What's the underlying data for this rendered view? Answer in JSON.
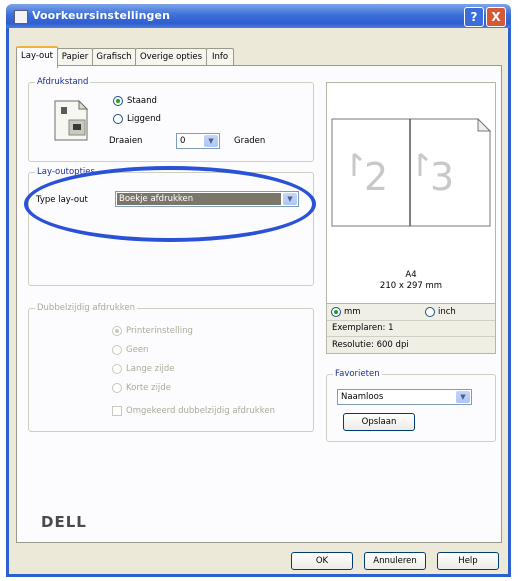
{
  "window": {
    "title": "Voorkeursinstellingen",
    "help_label": "?",
    "close_label": "X"
  },
  "tabs": [
    {
      "label": "Lay-out",
      "active": true
    },
    {
      "label": "Papier"
    },
    {
      "label": "Grafisch"
    },
    {
      "label": "Overige opties"
    },
    {
      "label": "Info"
    }
  ],
  "afdrukstand": {
    "title": "Afdrukstand",
    "staand": "Staand",
    "liggend": "Liggend",
    "draaien_label": "Draaien",
    "draaien_value": "0",
    "graden_label": "Graden",
    "selected": "Staand"
  },
  "layout_options": {
    "title": "Lay-outopties",
    "type_label": "Type lay-out",
    "type_value": "Boekje afdrukken"
  },
  "duplex": {
    "title": "Dubbelzijdig afdrukken",
    "options": [
      "Printerinstelling",
      "Geen",
      "Lange zijde",
      "Korte zijde"
    ],
    "selected": "Printerinstelling",
    "reverse_label": "Omgekeerd dubbelzijdig afdrukken"
  },
  "preview": {
    "page_left": "2",
    "page_right": "3",
    "paper": "A4",
    "dimensions": "210 x 297 mm",
    "unit_mm": "mm",
    "unit_inch": "inch",
    "unit_selected": "mm",
    "copies": "Exemplaren: 1",
    "resolution": "Resolutie: 600 dpi"
  },
  "favorites": {
    "title": "Favorieten",
    "value": "Naamloos",
    "save_label": "Opslaan"
  },
  "brand": "DELL",
  "buttons": {
    "ok": "OK",
    "cancel": "Annuleren",
    "help": "Help"
  },
  "colors": {
    "highlight_oval": "#2a52d8",
    "title_bar": "#3c6fd8",
    "selection": "#7a766a"
  }
}
